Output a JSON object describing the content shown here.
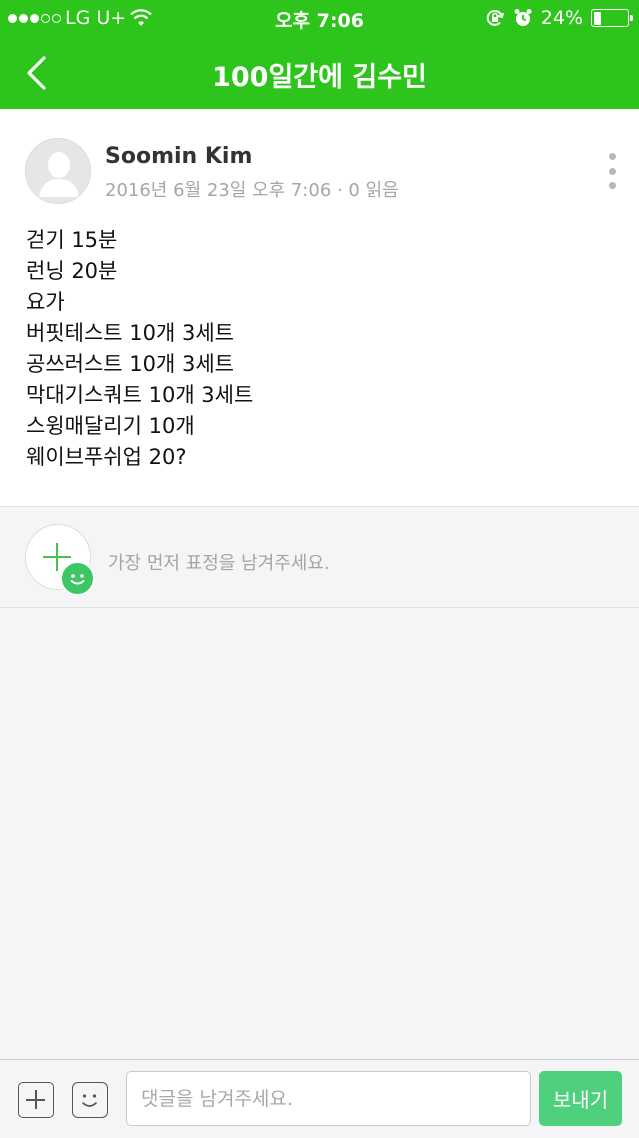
{
  "status_bar": {
    "carrier": "LG U+",
    "time": "오후 7:06",
    "battery": "24%",
    "battery_level": 0.24,
    "signal_bars_filled": 3,
    "signal_bars_total": 5
  },
  "navbar": {
    "title": "100일간에 김수민",
    "back_icon": "chevron-left-icon"
  },
  "post": {
    "author": "Soomin Kim",
    "meta": "2016년 6월 23일 오후 7:06 · 0 읽음",
    "lines": [
      "걷기 15분",
      "런닝 20분",
      "요가",
      "버핏테스트 10개 3세트",
      "공쓰러스트 10개 3세트",
      "막대기스쿼트 10개 3세트",
      "스윙매달리기 10개",
      "웨이브푸쉬업 20?"
    ]
  },
  "reaction": {
    "hint": "가장 먼저 표정을 남겨주세요."
  },
  "composer": {
    "placeholder": "댓글을 남겨주세요.",
    "send_label": "보내기"
  },
  "colors": {
    "header_green": "#2dc51b",
    "send_green": "#4fd07d",
    "smile_green": "#3cc664"
  }
}
